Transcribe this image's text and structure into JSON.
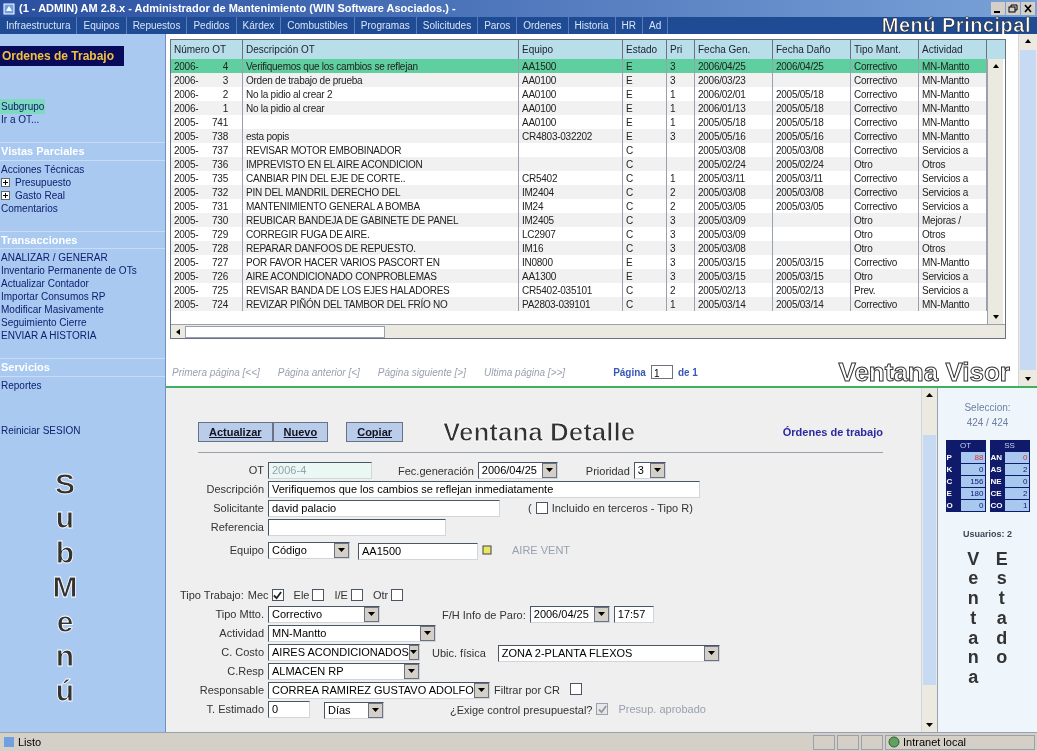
{
  "window": {
    "title": "(1 - ADMIN) AM 2.8.x - Administrador de Mantenimiento (WIN Software Asociados.) -"
  },
  "menu": [
    "Infraestructura",
    "Equipos",
    "Repuestos",
    "Pedidos",
    "Kárdex",
    "Combustibles",
    "Programas",
    "Solicitudes",
    "Paros",
    "Ordenes",
    "Historia",
    "HR",
    "Ad"
  ],
  "sidebar": {
    "title": "Ordenes de Trabajo",
    "sections": [
      {
        "items": [
          {
            "label": "Subgrupo",
            "selected": true
          },
          {
            "label": "Ir a OT...",
            "selected": false
          }
        ]
      },
      {
        "heading": "Vistas Parciales",
        "items": [
          {
            "label": "Acciones Técnicas",
            "selected": false
          },
          {
            "label": "Presupuesto",
            "selected": false,
            "expandable": true
          },
          {
            "label": "Gasto Real",
            "selected": false,
            "expandable": true
          },
          {
            "label": "Comentarios",
            "selected": false
          }
        ]
      },
      {
        "heading": "Transacciones",
        "items": [
          {
            "label": "ANALIZAR / GENERAR",
            "selected": false
          },
          {
            "label": "Inventario Permanente de OTs",
            "selected": false
          },
          {
            "label": "Actualizar Contador",
            "selected": false
          },
          {
            "label": "Importar Consumos RP",
            "selected": false
          },
          {
            "label": "Modificar Masivamente",
            "selected": false
          },
          {
            "label": "Seguimiento Cierre",
            "selected": false
          },
          {
            "label": "ENVIAR A HISTORIA",
            "selected": false
          }
        ]
      },
      {
        "heading": "Servicios",
        "items": [
          {
            "label": "Reportes",
            "selected": false
          }
        ]
      },
      {
        "items": [
          {
            "label": "Reiniciar SESION",
            "selected": false
          }
        ]
      }
    ]
  },
  "table": {
    "columns": [
      "Número OT",
      "Descripción OT",
      "Equipo",
      "Estado",
      "Pri",
      "Fecha Gen.",
      "Fecha Daño",
      "Tipo Mant.",
      "Actividad"
    ],
    "rows": [
      {
        "year": "2006-",
        "num": "4",
        "desc": "Verifiquemos que los cambios se reflejan",
        "equipo": "AA1500",
        "estado": "E",
        "pri": "3",
        "fgen": "2006/04/25",
        "fdano": "2006/04/25",
        "tipo": "Correctivo",
        "act": "MN-Mantto",
        "selected": true
      },
      {
        "year": "2006-",
        "num": "3",
        "desc": "Orden de trabajo de prueba",
        "equipo": "AA0100",
        "estado": "E",
        "pri": "3",
        "fgen": "2006/03/23",
        "tipo": "Correctivo",
        "act": "MN-Mantto",
        "selected": false
      },
      {
        "year": "2006-",
        "num": "2",
        "desc": "No la pidio al crear 2",
        "equipo": "AA0100",
        "estado": "E",
        "pri": "1",
        "fgen": "2006/02/01",
        "fdano": "2005/05/18",
        "tipo": "Correctivo",
        "act": "MN-Mantto",
        "selected": false
      },
      {
        "year": "2006-",
        "num": "1",
        "desc": "No la pidio al crear",
        "equipo": "AA0100",
        "estado": "E",
        "pri": "1",
        "fgen": "2006/01/13",
        "fdano": "2005/05/18",
        "tipo": "Correctivo",
        "act": "MN-Mantto",
        "selected": false
      },
      {
        "year": "2005-",
        "num": "741",
        "equipo": "AA0100",
        "estado": "E",
        "pri": "1",
        "fgen": "2005/05/18",
        "fdano": "2005/05/18",
        "tipo": "Correctivo",
        "act": "MN-Mantto",
        "selected": false
      },
      {
        "year": "2005-",
        "num": "738",
        "desc": "esta popis",
        "equipo": "CR4803-032202",
        "estado": "E",
        "pri": "3",
        "fgen": "2005/05/16",
        "fdano": "2005/05/16",
        "tipo": "Correctivo",
        "act": "MN-Mantto",
        "selected": false
      },
      {
        "year": "2005-",
        "num": "737",
        "desc": "REVISAR MOTOR EMBOBINADOR",
        "estado": "C",
        "fgen": "2005/03/08",
        "fdano": "2005/03/08",
        "tipo": "Correctivo",
        "act": "Servicios a",
        "selected": false
      },
      {
        "year": "2005-",
        "num": "736",
        "desc": "IMPREVISTO EN EL AIRE ACONDICION",
        "estado": "C",
        "fgen": "2005/02/24",
        "fdano": "2005/02/24",
        "tipo": "Otro",
        "act": "Otros",
        "selected": false
      },
      {
        "year": "2005-",
        "num": "735",
        "desc": "CANBIAR PIN DEL EJE DE CORTE..",
        "equipo": "CR5402",
        "estado": "C",
        "pri": "1",
        "fgen": "2005/03/11",
        "fdano": "2005/03/11",
        "tipo": "Correctivo",
        "act": "Servicios a",
        "selected": false
      },
      {
        "year": "2005-",
        "num": "732",
        "desc": "PIN DEL MANDRIL DERECHO DEL",
        "equipo": "IM2404",
        "estado": "C",
        "pri": "2",
        "fgen": "2005/03/08",
        "fdano": "2005/03/08",
        "tipo": "Correctivo",
        "act": "Servicios a",
        "selected": false
      },
      {
        "year": "2005-",
        "num": "731",
        "desc": "MANTENIMIENTO GENERAL A BOMBA",
        "equipo": "IM24",
        "estado": "C",
        "pri": "2",
        "fgen": "2005/03/05",
        "fdano": "2005/03/05",
        "tipo": "Correctivo",
        "act": "Servicios a",
        "selected": false
      },
      {
        "year": "2005-",
        "num": "730",
        "desc": "REUBICAR BANDEJA DE GABINETE DE PANEL",
        "equipo": "IM2405",
        "estado": "C",
        "pri": "3",
        "fgen": "2005/03/09",
        "tipo": "Otro",
        "act": "Mejoras /",
        "selected": false
      },
      {
        "year": "2005-",
        "num": "729",
        "desc": "CORREGIR FUGA DE AIRE.",
        "equipo": "LC2907",
        "estado": "C",
        "pri": "3",
        "fgen": "2005/03/09",
        "tipo": "Otro",
        "act": "Otros",
        "selected": false
      },
      {
        "year": "2005-",
        "num": "728",
        "desc": "REPARAR DANFOOS DE REPUESTO.",
        "equipo": "IM16",
        "estado": "C",
        "pri": "3",
        "fgen": "2005/03/08",
        "tipo": "Otro",
        "act": "Otros",
        "selected": false
      },
      {
        "year": "2005-",
        "num": "727",
        "desc": "POR FAVOR HACER VARIOS PASCORT EN",
        "equipo": "IN0800",
        "estado": "E",
        "pri": "3",
        "fgen": "2005/03/15",
        "fdano": "2005/03/15",
        "tipo": "Correctivo",
        "act": "MN-Mantto",
        "selected": false
      },
      {
        "year": "2005-",
        "num": "726",
        "desc": "AIRE ACONDICIONADO CONPROBLEMAS",
        "equipo": "AA1300",
        "estado": "E",
        "pri": "3",
        "fgen": "2005/03/15",
        "fdano": "2005/03/15",
        "tipo": "Otro",
        "act": "Servicios a",
        "selected": false
      },
      {
        "year": "2005-",
        "num": "725",
        "desc": "REVISAR BANDA DE LOS EJES HALADORES",
        "equipo": "CR5402-035101",
        "estado": "C",
        "pri": "2",
        "fgen": "2005/02/13",
        "fdano": "2005/02/13",
        "tipo": "Prev.",
        "act": "Servicios a",
        "selected": false
      },
      {
        "year": "2005-",
        "num": "724",
        "desc": "REVIZAR PIÑÓN DEL TAMBOR DEL FRÍO NO",
        "equipo": "PA2803-039101",
        "estado": "C",
        "pri": "1",
        "fgen": "2005/03/14",
        "fdano": "2005/03/14",
        "tipo": "Correctivo",
        "act": "MN-Mantto",
        "selected": false
      }
    ]
  },
  "pager": {
    "links": [
      "Primera página [<<]",
      "Página anterior [<]",
      "Página siguiente [>]",
      "Ultima página [>>]"
    ],
    "label": "Página",
    "value": "1",
    "total": "de 1"
  },
  "detail": {
    "buttons": [
      "Actualizar",
      "Nuevo",
      "Copiar"
    ],
    "title": "Órdenes de trabajo",
    "ot": {
      "label": "OT",
      "value": "2006-4",
      "disabled": true
    },
    "fec_generacion": {
      "label": "Fec.generación",
      "value": "2006/04/25"
    },
    "prioridad": {
      "label": "Prioridad",
      "value": "3"
    },
    "descripcion": {
      "label": "Descripción",
      "value": "Verifiquemos que los cambios se reflejan inmediatamente"
    },
    "solicitante": {
      "label": "Solicitante",
      "value": "david palacio"
    },
    "incluido": {
      "open": "(",
      "label": "Incluido en terceros - Tipo R)",
      "checked": false
    },
    "referencia": {
      "label": "Referencia"
    },
    "equipo": {
      "label": "Equipo",
      "mode": "Código",
      "value": "AA1500",
      "name": "AIRE VENT"
    },
    "tipo_trabajo": {
      "label": "Tipo Trabajo:",
      "options": [
        {
          "label": "Mec",
          "checked": true
        },
        {
          "label": "Ele",
          "checked": false
        },
        {
          "label": "I/E",
          "checked": false
        },
        {
          "label": "Otr",
          "checked": false
        }
      ]
    },
    "tipo_mtto": {
      "label": "Tipo Mtto.",
      "value": "Correctivo"
    },
    "paro": {
      "label": "F/H Info de Paro:",
      "date": "2006/04/25",
      "time": "17:57"
    },
    "actividad": {
      "label": "Actividad",
      "value": "MN-Mantto"
    },
    "c_costo": {
      "label": "C. Costo",
      "value": "AIRES ACONDICIONADOS"
    },
    "ubicacion": {
      "label": "Ubic. física",
      "value": "ZONA 2-PLANTA FLEXOS"
    },
    "c_resp": {
      "label": "C.Resp",
      "value": "ALMACEN RP"
    },
    "responsable": {
      "label": "Responsable",
      "value": "CORREA RAMIREZ GUSTAVO ADOLFO"
    },
    "filtrar": {
      "label": "Filtrar por CR",
      "checked": false
    },
    "t_estimado": {
      "label": "T. Estimado",
      "value": "0",
      "unit": "Días"
    },
    "exige": {
      "label": "¿Exige control presupuestal?",
      "checked": true,
      "disabled": true
    },
    "presup": {
      "label": "Presup. aprobado"
    }
  },
  "status_panel": {
    "seleccion_label": "Seleccion:",
    "seleccion": "424 / 424",
    "groups": [
      {
        "heading": "OT",
        "rows": [
          {
            "key": "P",
            "value": "88",
            "alert": true
          },
          {
            "key": "K",
            "value": "0",
            "alert": false
          },
          {
            "key": "C",
            "value": "156",
            "alert": false
          },
          {
            "key": "E",
            "value": "180",
            "alert": false
          },
          {
            "key": "O",
            "value": "0",
            "alert": false
          }
        ]
      },
      {
        "heading": "SS",
        "rows": [
          {
            "key": "AN",
            "value": "0",
            "alert": true
          },
          {
            "key": "AS",
            "value": "2",
            "alert": false
          },
          {
            "key": "NE",
            "value": "0",
            "alert": false
          },
          {
            "key": "CE",
            "value": "2",
            "alert": false
          },
          {
            "key": "CO",
            "value": "1",
            "alert": false
          }
        ]
      }
    ],
    "usuarios": "Usuarios: 2"
  },
  "annotations": [
    "Menú Principal",
    "Ventana Visor",
    "SubMenú",
    "Ventana Detalle",
    "Ventana",
    "Estado"
  ],
  "status_bar": {
    "text": "Listo",
    "zone": "Intranet local"
  }
}
